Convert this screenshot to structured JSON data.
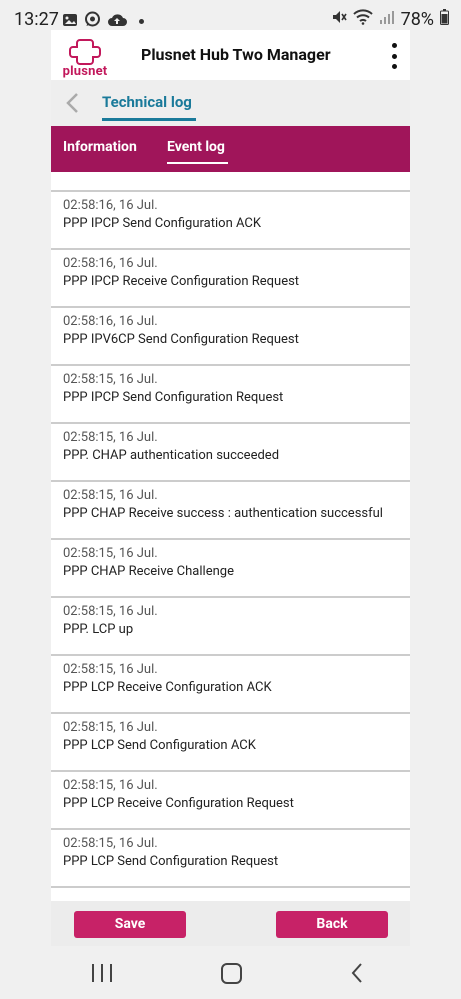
{
  "status_bar": {
    "time": "13:27",
    "battery": "78%",
    "icons_left": [
      "gallery-icon",
      "whatsapp-icon",
      "cloud-upload-icon",
      "dot"
    ],
    "icons_right": [
      "mute-icon",
      "wifi-icon",
      "signal-icon",
      "battery-icon"
    ]
  },
  "app_bar": {
    "logo_text": "plusnet",
    "title": "Plusnet Hub Two Manager",
    "menu_icon": "more-vertical-icon"
  },
  "subheader": {
    "title": "Technical log",
    "back_icon": "chevron-left-icon"
  },
  "tabs": [
    {
      "label": "Information",
      "active": false
    },
    {
      "label": "Event log",
      "active": true
    }
  ],
  "events": [
    {
      "time": "02:58:16, 16 Jul.",
      "message": "PPP IPCP Send Configuration ACK"
    },
    {
      "time": "02:58:16, 16 Jul.",
      "message": "PPP IPCP Receive Configuration Request"
    },
    {
      "time": "02:58:16, 16 Jul.",
      "message": "PPP IPV6CP Send Configuration Request"
    },
    {
      "time": "02:58:15, 16 Jul.",
      "message": "PPP IPCP Send Configuration Request"
    },
    {
      "time": "02:58:15, 16 Jul.",
      "message": "PPP. CHAP authentication succeeded"
    },
    {
      "time": "02:58:15, 16 Jul.",
      "message": "PPP CHAP Receive success : authentication successful"
    },
    {
      "time": "02:58:15, 16 Jul.",
      "message": "PPP CHAP Receive Challenge"
    },
    {
      "time": "02:58:15, 16 Jul.",
      "message": "PPP. LCP up"
    },
    {
      "time": "02:58:15, 16 Jul.",
      "message": "PPP LCP Receive Configuration ACK"
    },
    {
      "time": "02:58:15, 16 Jul.",
      "message": "PPP LCP Send Configuration ACK"
    },
    {
      "time": "02:58:15, 16 Jul.",
      "message": "PPP LCP Receive Configuration Request"
    },
    {
      "time": "02:58:15, 16 Jul.",
      "message": "PPP LCP Send Configuration Request"
    }
  ],
  "footer": {
    "save_label": "Save",
    "back_label": "Back"
  },
  "colors": {
    "brand": "#a0155a",
    "button": "#c72267",
    "accent": "#1a7a9a"
  },
  "nav_bar": {
    "icons": [
      "recent-apps-icon",
      "home-icon",
      "back-icon"
    ]
  }
}
